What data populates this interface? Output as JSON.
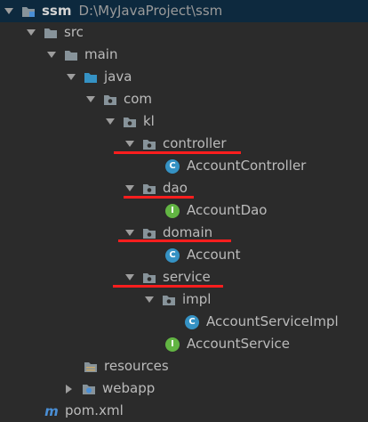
{
  "project": {
    "name": "ssm",
    "path": "D:\\MyJavaProject\\ssm"
  },
  "tree": {
    "src": "src",
    "main": "main",
    "java": "java",
    "com": "com",
    "kl": "kl",
    "controller": "controller",
    "account_controller": "AccountController",
    "dao": "dao",
    "account_dao": "AccountDao",
    "domain": "domain",
    "account": "Account",
    "service": "service",
    "impl": "impl",
    "account_service_impl": "AccountServiceImpl",
    "account_service": "AccountService",
    "resources": "resources",
    "webapp": "webapp",
    "pom": "pom.xml"
  },
  "badges": {
    "class": "C",
    "interface": "I",
    "maven": "m"
  },
  "colors": {
    "background": "#2b2b2b",
    "selection": "#0d293e",
    "class_badge": "#3592c4",
    "interface_badge": "#62b543",
    "annotation_underline": "#ff1e1e"
  }
}
